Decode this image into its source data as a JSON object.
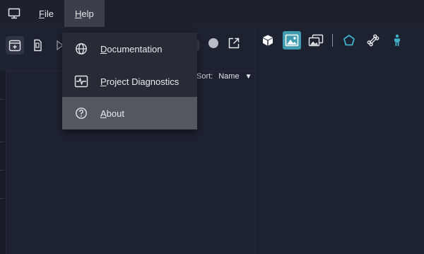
{
  "menubar": {
    "file_mnemonic": "F",
    "file_rest": "ile",
    "help_mnemonic": "H",
    "help_rest": "elp"
  },
  "help_menu": {
    "items": [
      {
        "mnemonic": "D",
        "rest": "ocumentation",
        "icon": "globe-icon"
      },
      {
        "mnemonic": "P",
        "rest": "roject Diagnostics",
        "icon": "diagnostics-icon"
      },
      {
        "mnemonic": "A",
        "rest": "bout",
        "icon": "question-icon"
      }
    ],
    "highlighted": "About"
  },
  "filesystem": {
    "sort_label": "Sort:",
    "sort_value": "Name"
  },
  "colors": {
    "accent": "#3e9bb0",
    "accent_icon": "#41b0c9",
    "background": "#1d2230",
    "menu_bg": "#262b36",
    "highlight": "#53575f"
  }
}
